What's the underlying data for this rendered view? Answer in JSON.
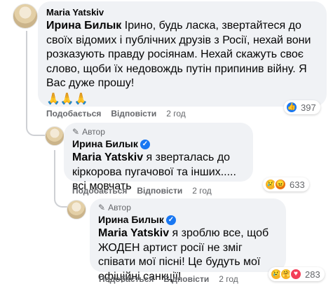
{
  "comment1": {
    "author": "Maria Yatskiv",
    "mention": "Ирина Билык",
    "text": " Ірино, будь ласка, звертайтеся до своїх відомих і публічних друзів з Росії, нехай вони розказують правду росіянам. Нехай скажуть своє слово, щоби їх недовождь путін припинив війну. Я Вас дуже прошу!",
    "emoji": "🙏🙏🙏",
    "actions": {
      "like": "Подобається",
      "reply": "Відповісти",
      "time": "2 год"
    },
    "reactions": {
      "count": "397"
    }
  },
  "comment2": {
    "author_tag": "Автор",
    "author": "Ирина Билык",
    "mention": "Maria Yatskiv",
    "text": " я зверталась до кіркорова пугачової та інших..... всі мовчать",
    "actions": {
      "like": "Подобається",
      "reply": "Відповісти",
      "time": "2 год"
    },
    "reactions": {
      "count": "633"
    }
  },
  "comment3": {
    "author_tag": "Автор",
    "author": "Ирина Билык",
    "mention": "Maria Yatskiv",
    "text": " я зроблю все, щоб ЖОДЕН артист росії не зміг співати мої пісні! Це будуть мої офіційні санкції!",
    "actions": {
      "like": "Подобається",
      "reply": "Відповісти",
      "time": "2 год"
    },
    "reactions": {
      "count": "283"
    }
  },
  "colors": {
    "bubble": "#f0f2f5",
    "like_blue": "#1877f2",
    "love_red": "#f33e58",
    "muted": "#65676b"
  }
}
